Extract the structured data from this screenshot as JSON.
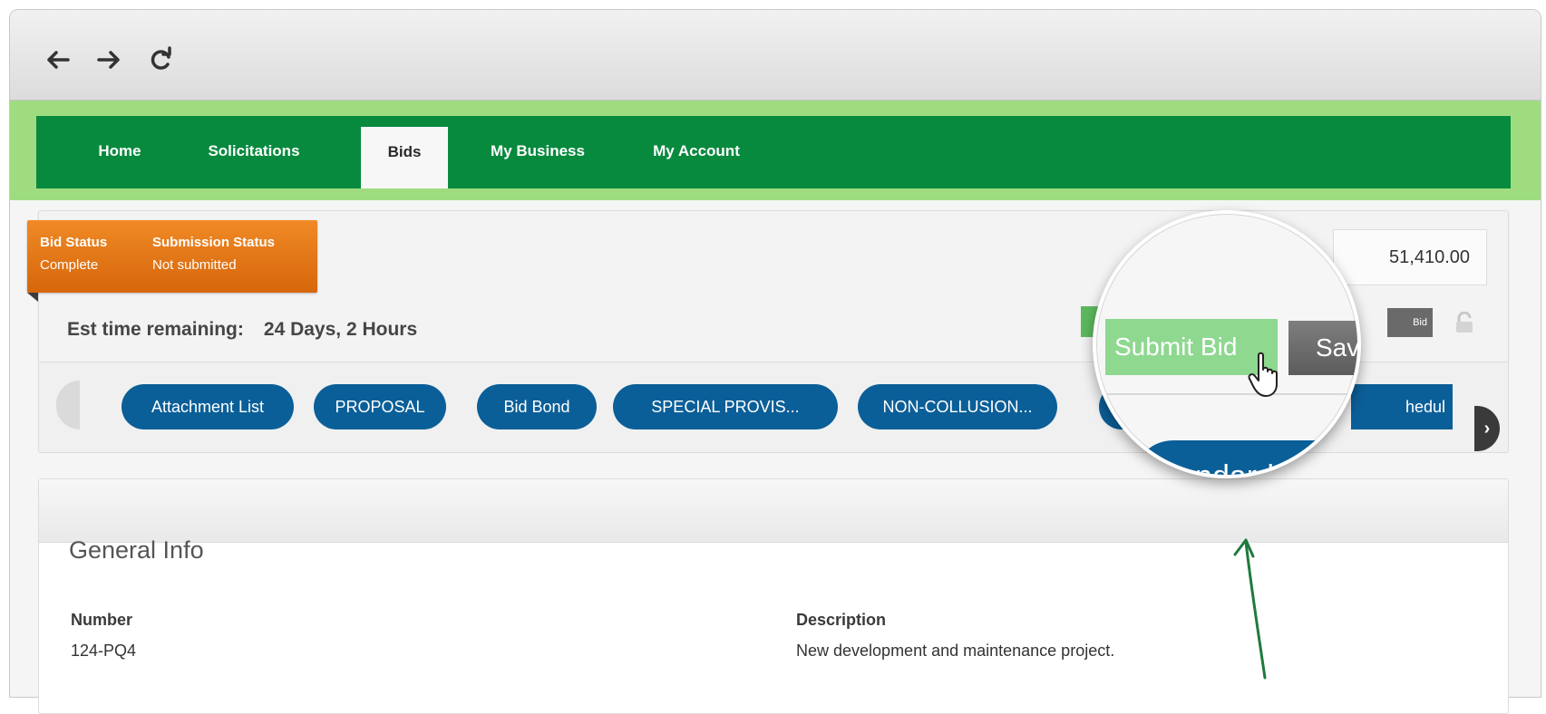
{
  "browser": {
    "nav_icons": [
      "back-arrow-icon",
      "forward-arrow-icon",
      "reload-icon"
    ]
  },
  "main_nav": {
    "tabs": [
      {
        "label": "Home"
      },
      {
        "label": "Solicitations"
      },
      {
        "label": "Bids",
        "active": true
      },
      {
        "label": "My Business"
      },
      {
        "label": "My Account"
      }
    ]
  },
  "status": {
    "bid_status_label": "Bid Status",
    "bid_status_value": "Complete",
    "submission_status_label": "Submission Status",
    "submission_status_value": "Not submitted"
  },
  "est_time": {
    "label": "Est time remaining:",
    "value": "24 Days, 2 Hours"
  },
  "amount": "51,410.00",
  "actions": {
    "submit_label": "Submit Bid",
    "save_label": "Save",
    "dark_btn_partial": "Bid"
  },
  "documents": {
    "pills": [
      "Attachment List",
      "PROPOSAL",
      "Bid Bond",
      "SPECIAL PROVIS...",
      "NON-COLLUSION...",
      "",
      "hedul"
    ],
    "magnified_pill": "Standard C"
  },
  "general_info": {
    "title": "General Info",
    "number_label": "Number",
    "number_value": "124-PQ4",
    "description_label": "Description",
    "description_value": "New development and maintenance project."
  },
  "colors": {
    "nav_green": "#088a3e",
    "band_green": "#9fdc80",
    "pill_blue": "#0b5f98",
    "status_orange": "#e07a18",
    "submit_green": "#8ed88f"
  }
}
